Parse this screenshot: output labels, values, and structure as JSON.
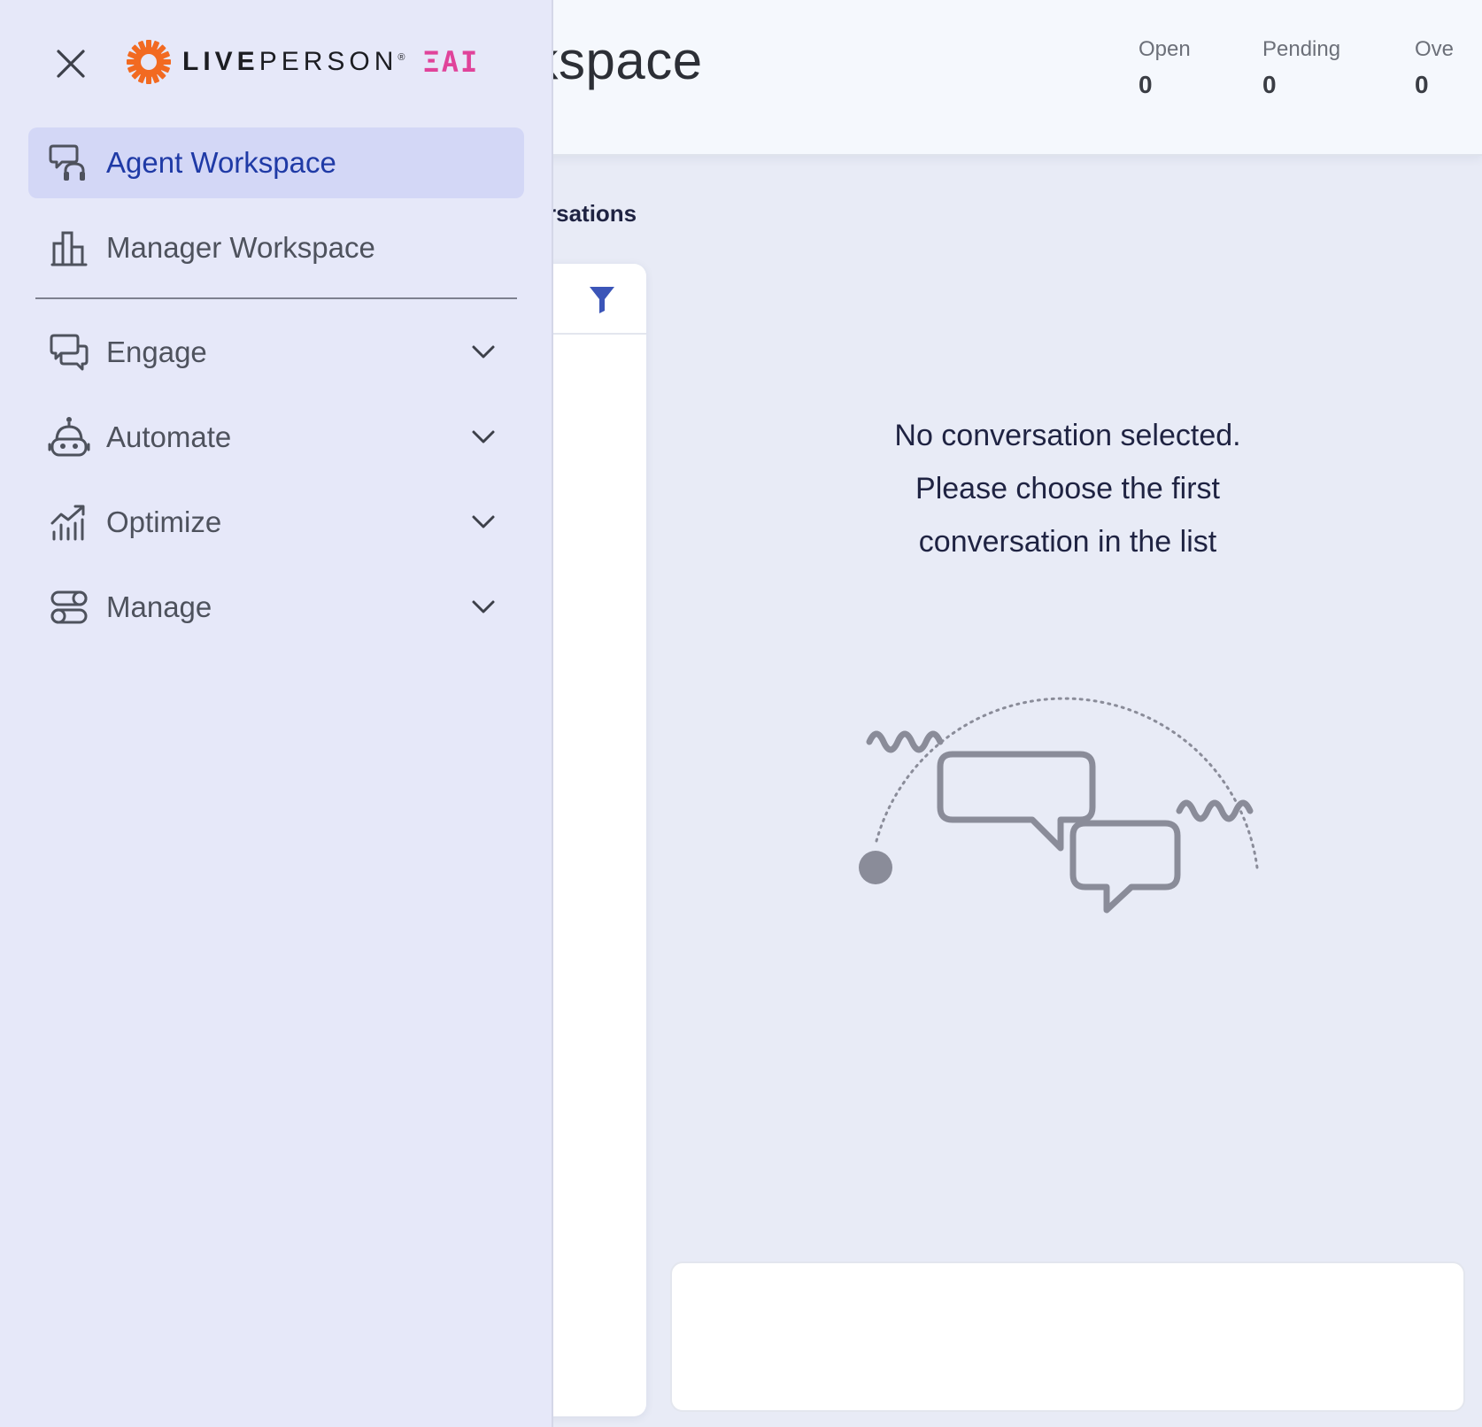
{
  "header": {
    "title": "rkspace",
    "stats": [
      {
        "label": "Open",
        "value": "0"
      },
      {
        "label": "Pending",
        "value": "0"
      },
      {
        "label": "Ove",
        "value": "0"
      }
    ]
  },
  "conversations": {
    "section_label": "rsations",
    "filter_icon": "filter-icon"
  },
  "empty_state": {
    "line1": "No conversation selected.",
    "line2": "Please choose the first",
    "line3": "conversation in the list"
  },
  "drawer": {
    "close_icon": "close-icon",
    "logo": {
      "brand_bold": "LIVE",
      "brand_light": "PERSON",
      "registered": "®",
      "suffix": "ΞAI"
    },
    "primary_items": [
      {
        "label": "Agent Workspace",
        "icon": "agent-headset-chat-icon",
        "active": true
      },
      {
        "label": "Manager Workspace",
        "icon": "bar-chart-icon",
        "active": false
      }
    ],
    "group_items": [
      {
        "label": "Engage",
        "icon": "chat-bubbles-icon"
      },
      {
        "label": "Automate",
        "icon": "robot-icon"
      },
      {
        "label": "Optimize",
        "icon": "trend-chart-icon"
      },
      {
        "label": "Manage",
        "icon": "toggles-icon"
      }
    ]
  },
  "colors": {
    "accent": "#1f3aa6",
    "drawer_bg": "#e6e8f9",
    "active_bg": "#d3d7f6",
    "logo_orange": "#f26a21",
    "eai_pink": "#e0439a"
  }
}
